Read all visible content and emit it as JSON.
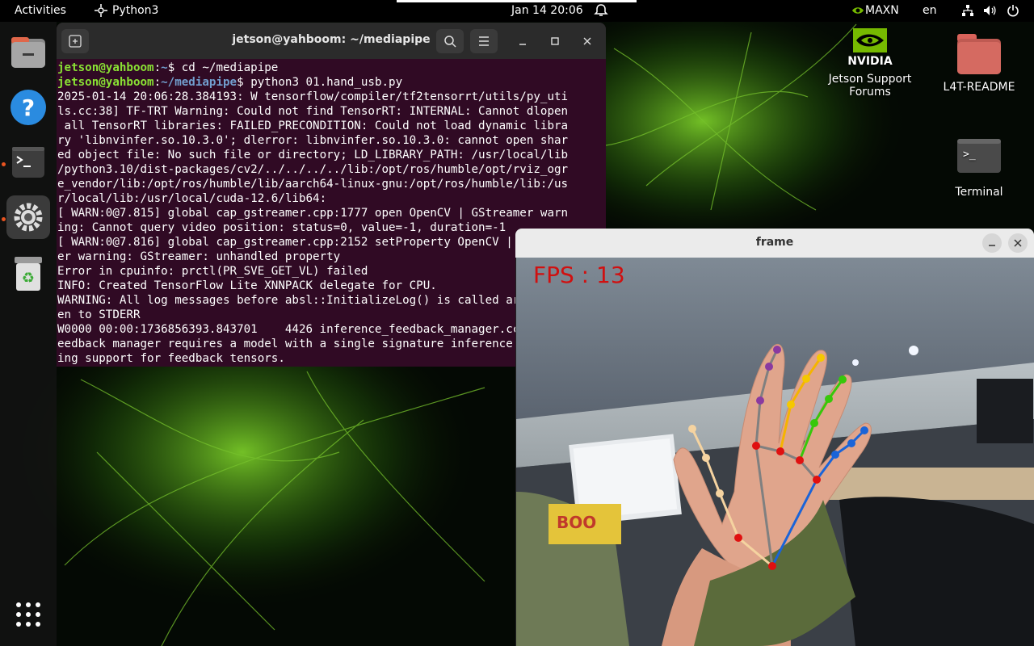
{
  "topbar": {
    "activities": "Activities",
    "app_name": "Python3",
    "clock": "Jan 14  20:06",
    "power_mode": "MAXN",
    "language": "en"
  },
  "dock": {
    "items": [
      "Files",
      "Help",
      "Terminal",
      "Settings",
      "Trash",
      "Show Applications"
    ]
  },
  "desktop": {
    "nvidia_logo": "NVIDIA",
    "icons": [
      {
        "label": "Jetson Support Forums",
        "line1": "Jetson Support",
        "line2": "Forums"
      },
      {
        "label": "L4T-README"
      },
      {
        "label": "Terminal",
        "glyph": ">_"
      }
    ]
  },
  "terminal": {
    "title": "jetson@yahboom: ~/mediapipe",
    "prompt_user": "jetson@yahboom",
    "prompt1_path": "~",
    "prompt1_cmd": "$ cd ~/mediapipe",
    "prompt2_path": "~/mediapipe",
    "prompt2_cmd": "$ python3 01.hand_usb.py",
    "output": "2025-01-14 20:06:28.384193: W tensorflow/compiler/tf2tensorrt/utils/py_uti\nls.cc:38] TF-TRT Warning: Could not find TensorRT: INTERNAL: Cannot dlopen\n all TensorRT libraries: FAILED_PRECONDITION: Could not load dynamic libra\nry 'libnvinfer.so.10.3.0'; dlerror: libnvinfer.so.10.3.0: cannot open shar\ned object file: No such file or directory; LD_LIBRARY_PATH: /usr/local/lib\n/python3.10/dist-packages/cv2/../../../../lib:/opt/ros/humble/opt/rviz_ogr\ne_vendor/lib:/opt/ros/humble/lib/aarch64-linux-gnu:/opt/ros/humble/lib:/us\nr/local/lib:/usr/local/cuda-12.6/lib64:\n[ WARN:0@7.815] global cap_gstreamer.cpp:1777 open OpenCV | GStreamer warn\ning: Cannot query video position: status=0, value=-1, duration=-1\n[ WARN:0@7.816] global cap_gstreamer.cpp:2152 setProperty OpenCV | GStream\ner warning: GStreamer: unhandled property\nError in cpuinfo: prctl(PR_SVE_GET_VL) failed\nINFO: Created TensorFlow Lite XNNPACK delegate for CPU.\nWARNING: All log messages before absl::InitializeLog() is called are written to STDERR\nen to STDERR\nW0000 00:00:1736856393.843701    4426 inference_feedback_manager.cc:114] F\needback manager requires a model with a single signature inference. Disabl\ning support for feedback tensors."
  },
  "frame_window": {
    "title": "frame",
    "fps_label": "FPS : 13"
  },
  "colors": {
    "terminal_bg": "#300a24",
    "prompt_user": "#8ae234",
    "prompt_path": "#729fcf",
    "accent": "#e95420",
    "fps_text": "#d01010"
  }
}
